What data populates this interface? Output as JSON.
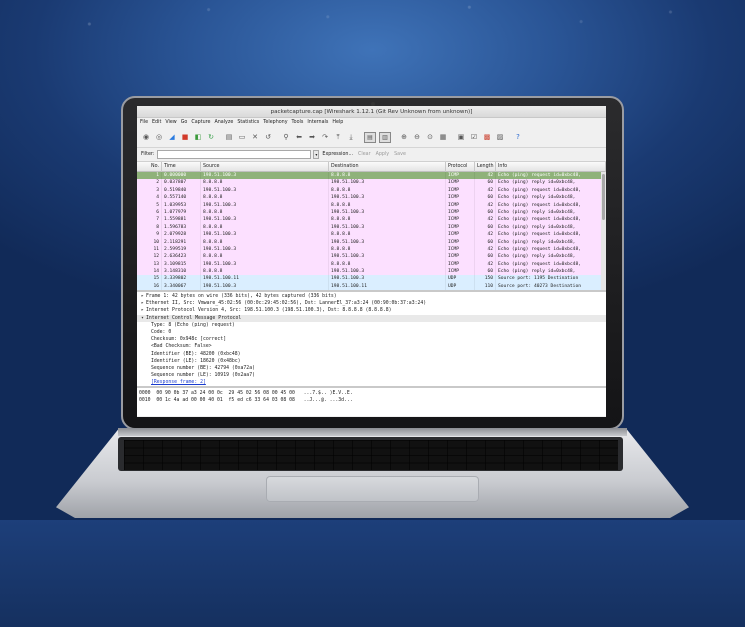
{
  "window": {
    "title": "packetcapture.cap  [Wireshark 1.12.1  (Git Rev Unknown from unknown)]"
  },
  "menu": [
    "File",
    "Edit",
    "View",
    "Go",
    "Capture",
    "Analyze",
    "Statistics",
    "Telephony",
    "Tools",
    "Internals",
    "Help"
  ],
  "filter": {
    "label": "Filter:",
    "value": "",
    "expression": "Expression...",
    "clear": "Clear",
    "apply": "Apply",
    "save": "Save"
  },
  "packet_list": {
    "columns": [
      "No.",
      "Time",
      "Source",
      "Destination",
      "Protocol",
      "Length",
      "Info"
    ],
    "rows": [
      {
        "no": "1",
        "time": "0.000000",
        "src": "198.51.100.3",
        "dst": "8.8.8.8",
        "proto": "ICMP",
        "len": "42",
        "info": "Echo (ping) request  id=0xbc48,",
        "kind": "sel"
      },
      {
        "no": "2",
        "time": "0.037807",
        "src": "8.8.8.8",
        "dst": "198.51.100.3",
        "proto": "ICMP",
        "len": "60",
        "info": "Echo (ping) reply    id=0xbc48,",
        "kind": "icmp"
      },
      {
        "no": "3",
        "time": "0.519840",
        "src": "198.51.100.3",
        "dst": "8.8.8.8",
        "proto": "ICMP",
        "len": "42",
        "info": "Echo (ping) request  id=0xbc48,",
        "kind": "icmp"
      },
      {
        "no": "4",
        "time": "0.557140",
        "src": "8.8.8.8",
        "dst": "198.51.100.3",
        "proto": "ICMP",
        "len": "60",
        "info": "Echo (ping) reply    id=0xbc48,",
        "kind": "icmp"
      },
      {
        "no": "5",
        "time": "1.039953",
        "src": "198.51.100.3",
        "dst": "8.8.8.8",
        "proto": "ICMP",
        "len": "42",
        "info": "Echo (ping) request  id=0xbc48,",
        "kind": "icmp"
      },
      {
        "no": "6",
        "time": "1.077979",
        "src": "8.8.8.8",
        "dst": "198.51.100.3",
        "proto": "ICMP",
        "len": "60",
        "info": "Echo (ping) reply    id=0xbc48,",
        "kind": "icmp"
      },
      {
        "no": "7",
        "time": "1.559881",
        "src": "198.51.100.3",
        "dst": "8.8.8.8",
        "proto": "ICMP",
        "len": "42",
        "info": "Echo (ping) request  id=0xbc48,",
        "kind": "icmp"
      },
      {
        "no": "8",
        "time": "1.596783",
        "src": "8.8.8.8",
        "dst": "198.51.100.3",
        "proto": "ICMP",
        "len": "60",
        "info": "Echo (ping) reply    id=0xbc48,",
        "kind": "icmp"
      },
      {
        "no": "9",
        "time": "2.079928",
        "src": "198.51.100.3",
        "dst": "8.8.8.8",
        "proto": "ICMP",
        "len": "42",
        "info": "Echo (ping) request  id=0xbc48,",
        "kind": "icmp"
      },
      {
        "no": "10",
        "time": "2.118291",
        "src": "8.8.8.8",
        "dst": "198.51.100.3",
        "proto": "ICMP",
        "len": "60",
        "info": "Echo (ping) reply    id=0xbc48,",
        "kind": "icmp"
      },
      {
        "no": "11",
        "time": "2.599519",
        "src": "198.51.100.3",
        "dst": "8.8.8.8",
        "proto": "ICMP",
        "len": "42",
        "info": "Echo (ping) request  id=0xbc48,",
        "kind": "icmp"
      },
      {
        "no": "12",
        "time": "2.636423",
        "src": "8.8.8.8",
        "dst": "198.51.100.3",
        "proto": "ICMP",
        "len": "60",
        "info": "Echo (ping) reply    id=0xbc48,",
        "kind": "icmp"
      },
      {
        "no": "13",
        "time": "3.109815",
        "src": "198.51.100.3",
        "dst": "8.8.8.8",
        "proto": "ICMP",
        "len": "42",
        "info": "Echo (ping) request  id=0xbc48,",
        "kind": "icmp"
      },
      {
        "no": "14",
        "time": "3.148310",
        "src": "8.8.8.8",
        "dst": "198.51.100.3",
        "proto": "ICMP",
        "len": "60",
        "info": "Echo (ping) reply    id=0xbc48,",
        "kind": "icmp"
      },
      {
        "no": "15",
        "time": "3.339802",
        "src": "198.51.100.11",
        "dst": "198.51.100.3",
        "proto": "UDP",
        "len": "150",
        "info": "Source port: 1195  Destination",
        "kind": "udp"
      },
      {
        "no": "16",
        "time": "3.340067",
        "src": "198.51.100.3",
        "dst": "198.51.100.11",
        "proto": "UDP",
        "len": "110",
        "info": "Source port: 40273  Destination",
        "kind": "udp"
      }
    ]
  },
  "details": [
    {
      "text": "Frame 1: 42 bytes on wire (336 bits), 42 bytes captured (336 bits)",
      "level": 0,
      "expanded": false
    },
    {
      "text": "Ethernet II, Src: Vmware_45:02:56 (00:0c:29:45:02:56), Dst: LannerEl_37:a3:24 (00:90:0b:37:a3:24)",
      "level": 0,
      "expanded": false
    },
    {
      "text": "Internet Protocol Version 4, Src: 198.51.100.3 (198.51.100.3), Dst: 8.8.8.8 (8.8.8.8)",
      "level": 0,
      "expanded": false
    },
    {
      "text": "Internet Control Message Protocol",
      "level": 0,
      "expanded": true
    },
    {
      "text": "Type: 8 (Echo (ping) request)",
      "level": 1
    },
    {
      "text": "Code: 0",
      "level": 1
    },
    {
      "text": "Checksum: 0x948c [correct]",
      "level": 1
    },
    {
      "text": "<Bad Checksum: False>",
      "level": 1
    },
    {
      "text": "Identifier (BE): 48200 (0xbc48)",
      "level": 1
    },
    {
      "text": "Identifier (LE): 18620 (0x48bc)",
      "level": 1
    },
    {
      "text": "Sequence number (BE): 42794 (0xa72a)",
      "level": 1
    },
    {
      "text": "Sequence number (LE): 10919 (0x2aa7)",
      "level": 1
    },
    {
      "text": "[Response frame: 2]",
      "level": 1,
      "link": true
    }
  ],
  "bytes": [
    "0000  00 90 0b 37 a3 24 00 0c  29 45 02 56 08 00 45 00   ...7.$.. )E.V..E.",
    "0010  00 1c 4a ad 00 00 40 01  f5 ed c6 33 64 03 08 08   ..J...@. ...3d..."
  ],
  "colors": {
    "selected_row": "#8fb27a",
    "icmp_row": "#fce0ff",
    "udp_row": "#daeeff",
    "link": "#1a3ccf"
  },
  "toolbar_icons": [
    "interface-list-icon",
    "capture-options-icon",
    "start-capture-icon",
    "stop-capture-icon",
    "restart-capture-icon",
    "open-file-icon",
    "save-file-icon",
    "close-file-icon",
    "reload-icon",
    "find-packet-icon",
    "go-back-icon",
    "go-forward-icon",
    "go-to-packet-icon",
    "go-first-icon",
    "go-last-icon",
    "colorize-icon",
    "auto-scroll-icon",
    "zoom-in-icon",
    "zoom-out-icon",
    "normal-size-icon",
    "resize-columns-icon",
    "capture-filters-icon",
    "display-filters-icon",
    "coloring-rules-icon",
    "preferences-icon",
    "help-icon"
  ]
}
